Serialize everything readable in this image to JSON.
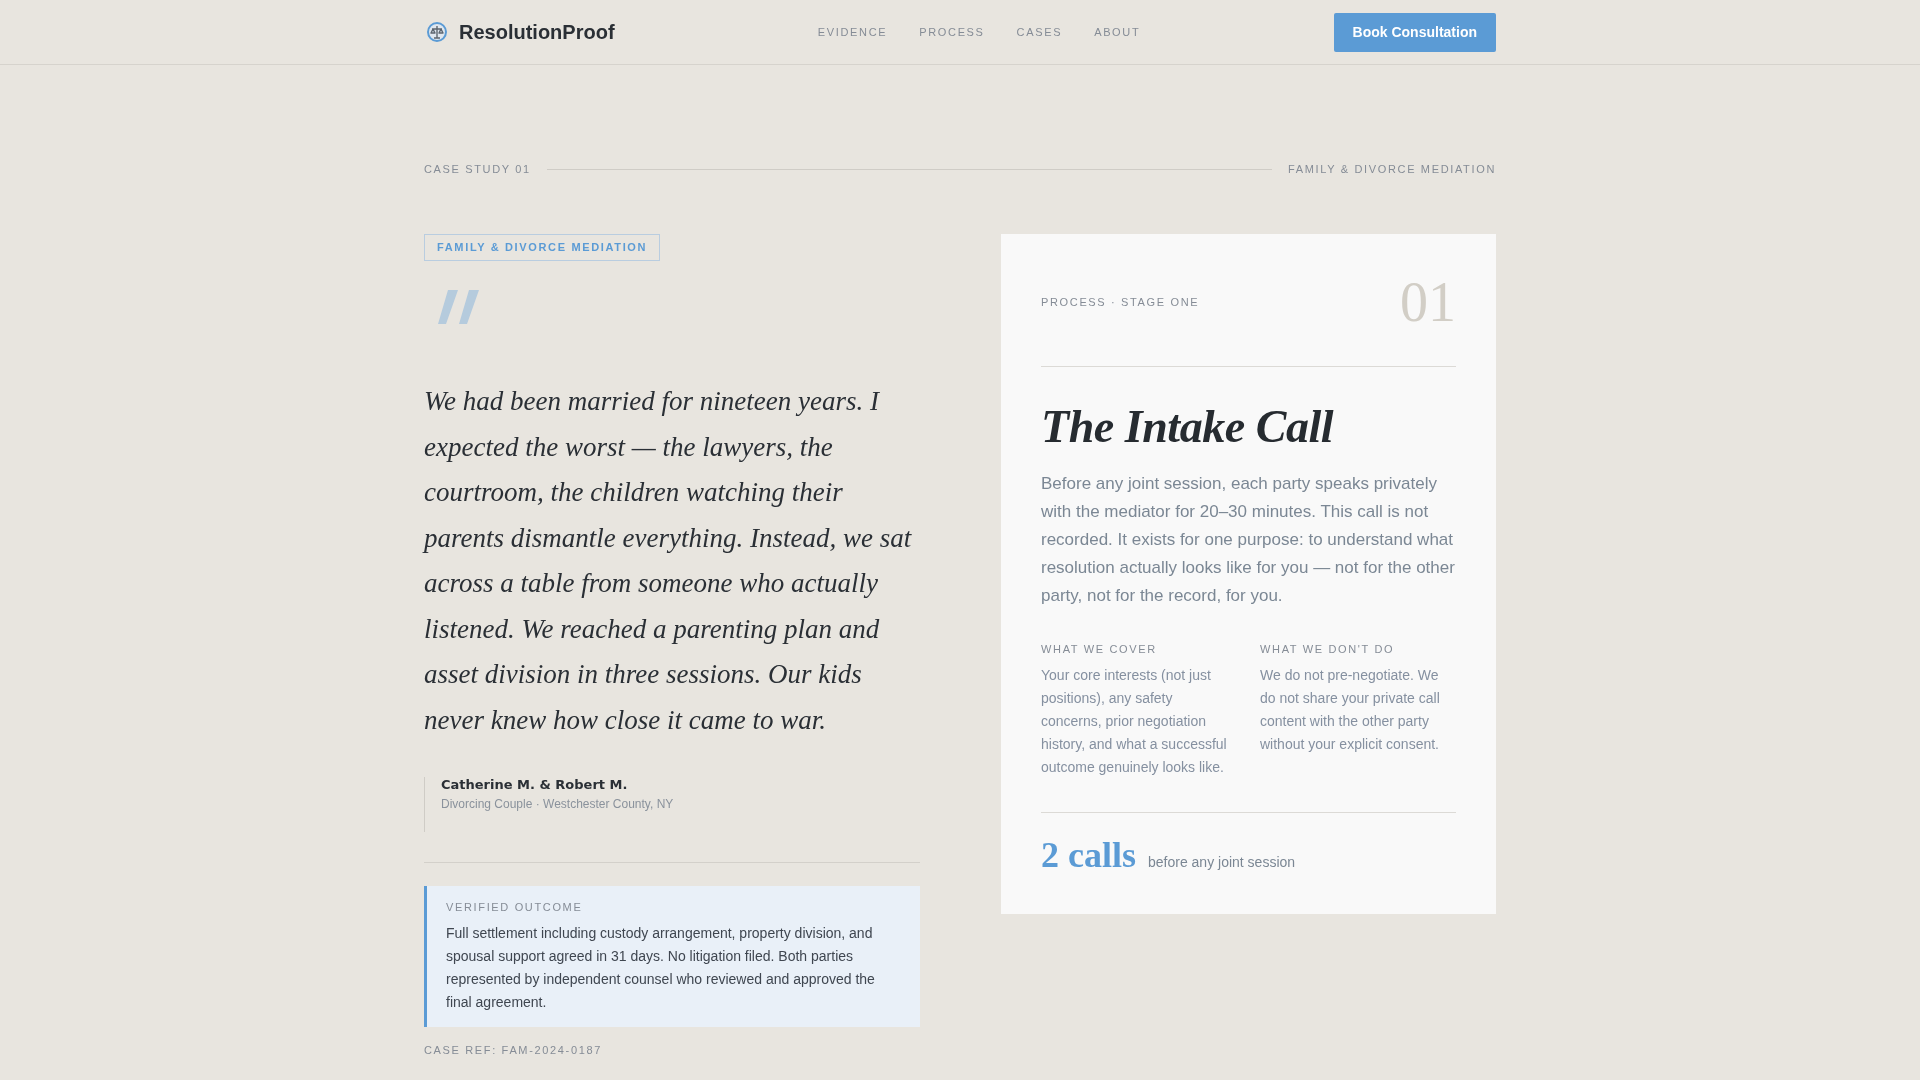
{
  "header": {
    "brand": "ResolutionProof",
    "nav": [
      "EVIDENCE",
      "PROCESS",
      "CASES",
      "ABOUT"
    ],
    "cta": "Book Consultation"
  },
  "case_bar": {
    "label": "CASE STUDY 01",
    "category": "FAMILY & DIVORCE MEDIATION"
  },
  "testimonial": {
    "tag": "FAMILY & DIVORCE MEDIATION",
    "quote": "We had been married for nineteen years. I expected the worst — the lawyers, the courtroom, the children watching their parents dismantle everything. Instead, we sat across a table from someone who actually listened. We reached a parenting plan and asset division in three sessions. Our kids never knew how close it came to war.",
    "author": "Catherine M. & Robert M.",
    "author_detail": "Divorcing Couple · Westchester County, NY",
    "outcome": {
      "label": "VERIFIED OUTCOME",
      "text": "Full settlement including custody arrangement, property division, and spousal support agreed in 31 days. No litigation filed. Both parties represented by independent counsel who reviewed and approved the final agreement."
    },
    "case_ref": "CASE REF: FAM-2024-0187"
  },
  "process_card": {
    "eyebrow": "PROCESS · STAGE ONE",
    "number": "01",
    "title": "The Intake Call",
    "body": "Before any joint session, each party speaks privately with the mediator for 20–30 minutes. This call is not recorded. It exists for one purpose: to understand what resolution actually looks like for you — not for the other party, not for the record, for you.",
    "columns": [
      {
        "heading": "WHAT WE COVER",
        "text": "Your core interests (not just positions), any safety concerns, prior negotiation history, and what a successful outcome genuinely looks like."
      },
      {
        "heading": "WHAT WE DON'T DO",
        "text": "We do not pre-negotiate. We do not share your private call content with the other party without your explicit consent."
      }
    ],
    "stat": {
      "value": "2 calls",
      "caption": "before any joint session"
    }
  }
}
